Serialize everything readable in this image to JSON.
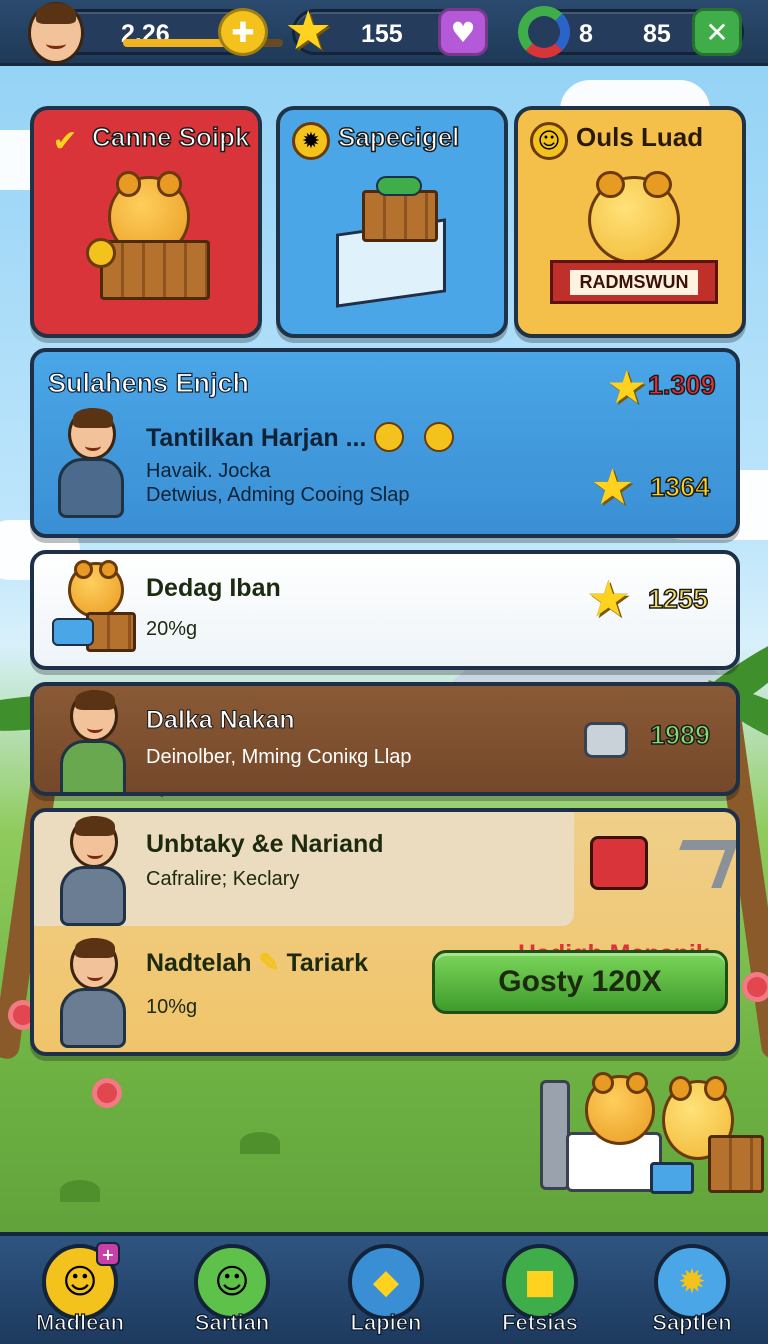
{
  "topbar": {
    "level_value": "2.26",
    "xp_fraction": 0.75,
    "stars_value": "155",
    "gems_value": "8",
    "coins_value": "85"
  },
  "offers": [
    {
      "title": "Canne Soipk",
      "color": "#d8343a"
    },
    {
      "title": "Sapecigel",
      "color": "#4aa6e6"
    },
    {
      "title": "Ouls Luad",
      "color": "#f5c04a",
      "ribbon": "RADMSWUN"
    }
  ],
  "list": {
    "row1": {
      "header": "Sulahens Enjch",
      "header_value": "1.309",
      "title": "Tantilkan Harjan ...",
      "sub1": "Havaik. Jocka",
      "sub2": "Detwius, Adming Cooing Slap",
      "value": "1364"
    },
    "row2": {
      "title": "Dedag Iban",
      "sub": "20%g",
      "value": "1255"
    },
    "row3": {
      "title": "Dalka Nakan",
      "sub": "Deinolber, Mming Coniкg Llap",
      "value": "1989"
    },
    "row4": {
      "item1_title": "Unbtaky &e Nariand",
      "item1_sub": "Cafralire; Keclary",
      "item2_title": "Nadtelah",
      "item2_title_tail": "Tariark",
      "item2_sub": "10%g",
      "promo": "Hadigh Menanik",
      "button": "Gosty 120X"
    }
  },
  "nav": [
    {
      "label": "Madlean",
      "icon": "avatar-icon"
    },
    {
      "label": "Sartian",
      "icon": "profile-icon"
    },
    {
      "label": "Lapien",
      "icon": "ticket-icon"
    },
    {
      "label": "Fetsias",
      "icon": "box-icon"
    },
    {
      "label": "Saptlen",
      "icon": "gear-icon"
    }
  ]
}
